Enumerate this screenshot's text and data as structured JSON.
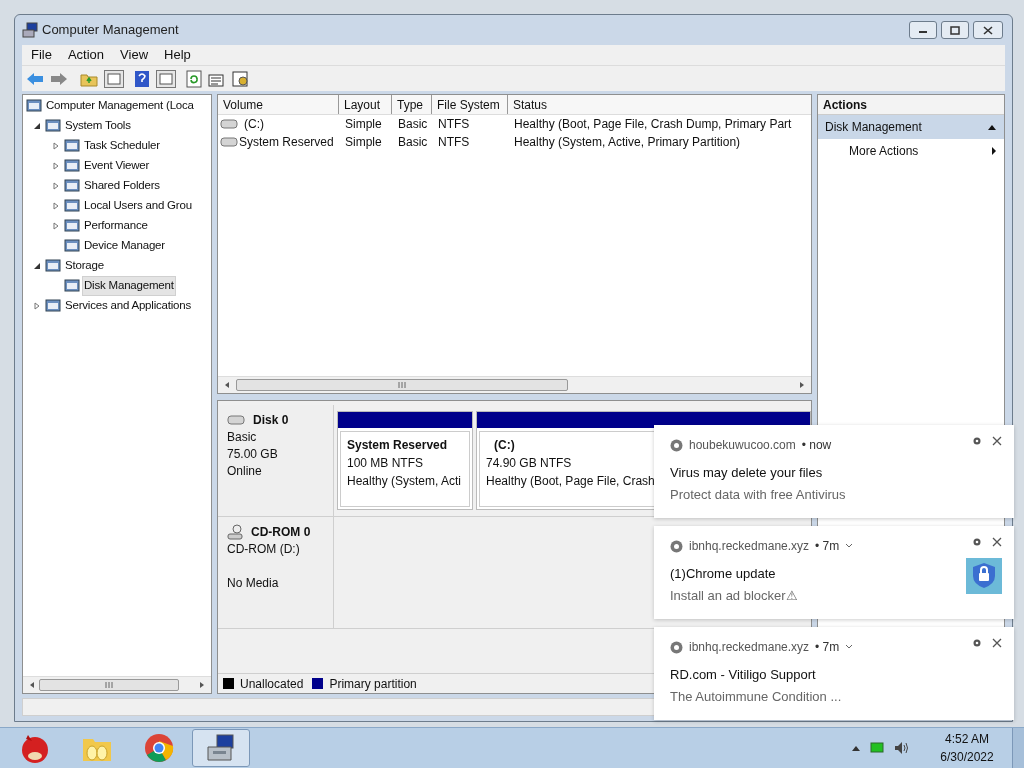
{
  "window": {
    "title": "Computer Management",
    "menu": [
      "File",
      "Action",
      "View",
      "Help"
    ]
  },
  "tree": [
    {
      "label": "Computer Management (Loca",
      "selected": false,
      "children": [
        {
          "label": "System Tools",
          "expanded": true,
          "selected": false,
          "children": [
            {
              "label": "Task Scheduler",
              "expanded": false,
              "selected": false
            },
            {
              "label": "Event Viewer",
              "expanded": false,
              "selected": false
            },
            {
              "label": "Shared Folders",
              "expanded": false,
              "selected": false
            },
            {
              "label": "Local Users and Grou",
              "expanded": false,
              "selected": false
            },
            {
              "label": "Performance",
              "expanded": false,
              "selected": false
            },
            {
              "label": "Device Manager",
              "selected": false
            }
          ]
        },
        {
          "label": "Storage",
          "expanded": true,
          "selected": false,
          "children": [
            {
              "label": "Disk Management",
              "selected": true
            }
          ]
        },
        {
          "label": "Services and Applications",
          "expanded": false,
          "selected": false
        }
      ]
    }
  ],
  "volumes": {
    "columns": [
      "Volume",
      "Layout",
      "Type",
      "File System",
      "Status"
    ],
    "rows": [
      [
        "(C:)",
        "Simple",
        "Basic",
        "NTFS",
        "Healthy (Boot, Page File, Crash Dump, Primary Part"
      ],
      [
        "System Reserved",
        "Simple",
        "Basic",
        "NTFS",
        "Healthy (System, Active, Primary Partition)"
      ]
    ]
  },
  "disks": [
    {
      "kind": "disk",
      "name": "Disk 0",
      "details": [
        "Basic",
        "75.00 GB",
        "Online"
      ],
      "partitions": [
        {
          "title": "System Reserved",
          "size": "100 MB NTFS",
          "status": "Healthy (System, Acti"
        },
        {
          "title": "(C:)",
          "size": "74.90 GB NTFS",
          "status": "Healthy (Boot, Page File, Crash"
        }
      ]
    },
    {
      "kind": "cdrom",
      "name": "CD-ROM 0",
      "details": [
        "CD-ROM (D:)",
        "No Media"
      ]
    }
  ],
  "legend": [
    {
      "label": "Unallocated",
      "color": "#000000"
    },
    {
      "label": "Primary partition",
      "color": "#00008b"
    }
  ],
  "actions": {
    "title": "Actions",
    "section": "Disk Management",
    "expanded": true,
    "items": [
      "More Actions"
    ]
  },
  "notifications": [
    {
      "site": "houbekuwucoo.com",
      "time": "• now",
      "menu": false,
      "title": "Virus may delete your files",
      "body": "Protect data with free Antivirus",
      "image": false
    },
    {
      "site": "ibnhq.reckedmane.xyz",
      "time": "• 7m",
      "menu": true,
      "title": "(1)Chrome update",
      "body": "Install an ad blocker⚠",
      "image": true
    },
    {
      "site": "ibnhq.reckedmane.xyz",
      "time": "• 7m",
      "menu": true,
      "title": "RD.com - Vitiligo Support",
      "body": "The Autoimmune Condition ...",
      "image": false
    }
  ],
  "taskbar": {
    "apps": [
      {
        "kind": "game",
        "selected": false
      },
      {
        "kind": "folder",
        "selected": false
      },
      {
        "kind": "browser",
        "selected": false
      },
      {
        "kind": "management",
        "selected": true
      }
    ],
    "time": "4:52 AM",
    "date": "6/30/2022"
  }
}
